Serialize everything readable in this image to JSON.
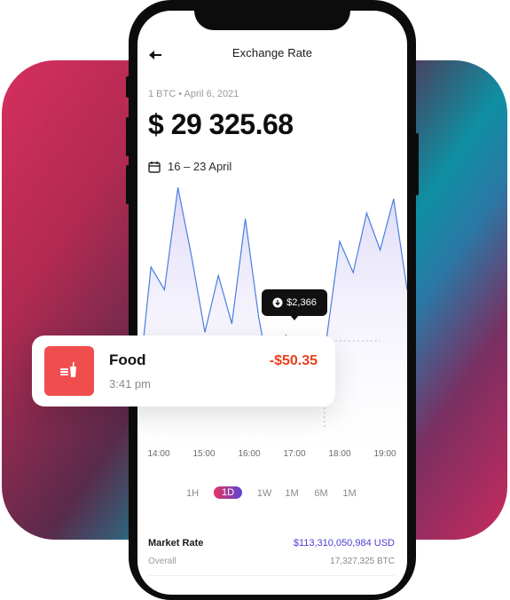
{
  "header": {
    "title": "Exchange Rate"
  },
  "subtitle": "1 BTC • April 6, 2021",
  "price": "$ 29 325.68",
  "date_range": "16 – 23 April",
  "tooltip": {
    "value": "$2,366"
  },
  "transaction": {
    "category": "Food",
    "time": "3:41 pm",
    "amount": "-$50.35",
    "icon": "food-drink-icon"
  },
  "time_axis": [
    "14:00",
    "15:00",
    "16:00",
    "17:00",
    "18:00",
    "19:00"
  ],
  "periods": [
    {
      "label": "1H",
      "active": false
    },
    {
      "label": "1D",
      "active": true
    },
    {
      "label": "1W",
      "active": false
    },
    {
      "label": "1M",
      "active": false
    },
    {
      "label": "6M",
      "active": false
    },
    {
      "label": "1M",
      "active": false
    }
  ],
  "market": {
    "label": "Market Rate",
    "usd": "$113,310,050,984 USD",
    "overall_label": "Overall",
    "btc": "17,327,325 BTC"
  },
  "colors": {
    "accent": "#4a3fcf",
    "negative": "#e8401c",
    "food_icon_bg": "#f04e4e",
    "line": "#4a7ee0"
  },
  "chart_data": {
    "type": "area",
    "series": [
      {
        "values": [
          20,
          66,
          58,
          94,
          70,
          43,
          63,
          46,
          83,
          48,
          23,
          42,
          38,
          41,
          40,
          75,
          64,
          85,
          72,
          90,
          58
        ]
      }
    ],
    "ylim": [
      0,
      100
    ],
    "highlight_index": 14
  }
}
